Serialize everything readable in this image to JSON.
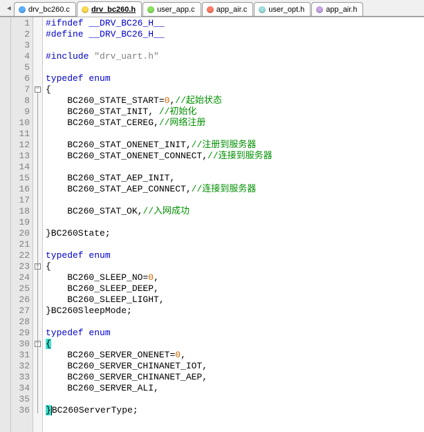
{
  "tabs": [
    {
      "label": "drv_bc260.c",
      "dot": "dot-blue",
      "active": false
    },
    {
      "label": "drv_bc260.h",
      "dot": "dot-yellow",
      "active": true
    },
    {
      "label": "user_app.c",
      "dot": "dot-green",
      "active": false
    },
    {
      "label": "app_air.c",
      "dot": "dot-red",
      "active": false
    },
    {
      "label": "user_opt.h",
      "dot": "dot-cyan",
      "active": false
    },
    {
      "label": "app_air.h",
      "dot": "dot-purple",
      "active": false
    }
  ],
  "nav_arrow": "◄",
  "fold_markers": [
    7,
    23,
    30
  ],
  "code_lines": [
    {
      "n": 1,
      "tokens": [
        [
          "#ifndef __DRV_BC26_H__",
          "c-kw"
        ]
      ]
    },
    {
      "n": 2,
      "tokens": [
        [
          "#define __DRV_BC26_H__",
          "c-kw"
        ]
      ]
    },
    {
      "n": 3,
      "tokens": []
    },
    {
      "n": 4,
      "tokens": [
        [
          "#include ",
          "c-kw"
        ],
        [
          "\"drv_uart.h\"",
          "c-str"
        ]
      ]
    },
    {
      "n": 5,
      "tokens": []
    },
    {
      "n": 6,
      "tokens": [
        [
          "typedef",
          "c-kw"
        ],
        [
          " ",
          ""
        ],
        [
          "enum",
          "c-kw"
        ]
      ]
    },
    {
      "n": 7,
      "tokens": [
        [
          "{",
          "c-id"
        ]
      ]
    },
    {
      "n": 8,
      "tokens": [
        [
          "    BC260_STATE_START",
          "c-id"
        ],
        [
          "=",
          "c-id"
        ],
        [
          "0",
          "c-num"
        ],
        [
          ",",
          "c-id"
        ],
        [
          "//起始状态",
          "c-com"
        ]
      ]
    },
    {
      "n": 9,
      "tokens": [
        [
          "    BC260_STAT_INIT, ",
          "c-id"
        ],
        [
          "//初始化",
          "c-com"
        ]
      ]
    },
    {
      "n": 10,
      "tokens": [
        [
          "    BC260_STAT_CEREG,",
          "c-id"
        ],
        [
          "//网络注册",
          "c-com"
        ]
      ]
    },
    {
      "n": 11,
      "tokens": []
    },
    {
      "n": 12,
      "tokens": [
        [
          "    BC260_STAT_ONENET_INIT,",
          "c-id"
        ],
        [
          "//注册到服务器",
          "c-com"
        ]
      ]
    },
    {
      "n": 13,
      "tokens": [
        [
          "    BC260_STAT_ONENET_CONNECT,",
          "c-id"
        ],
        [
          "//连接到服务器",
          "c-com"
        ]
      ]
    },
    {
      "n": 14,
      "tokens": []
    },
    {
      "n": 15,
      "tokens": [
        [
          "    BC260_STAT_AEP_INIT,",
          "c-id"
        ]
      ]
    },
    {
      "n": 16,
      "tokens": [
        [
          "    BC260_STAT_AEP_CONNECT,",
          "c-id"
        ],
        [
          "//连接到服务器",
          "c-com"
        ]
      ]
    },
    {
      "n": 17,
      "tokens": []
    },
    {
      "n": 18,
      "tokens": [
        [
          "    BC260_STAT_OK,",
          "c-id"
        ],
        [
          "//入网成功",
          "c-com"
        ]
      ]
    },
    {
      "n": 19,
      "tokens": []
    },
    {
      "n": 20,
      "tokens": [
        [
          "}BC260State;",
          "c-id"
        ]
      ]
    },
    {
      "n": 21,
      "tokens": []
    },
    {
      "n": 22,
      "tokens": [
        [
          "typedef",
          "c-kw"
        ],
        [
          " ",
          ""
        ],
        [
          "enum",
          "c-kw"
        ]
      ]
    },
    {
      "n": 23,
      "tokens": [
        [
          "{",
          "c-id"
        ]
      ]
    },
    {
      "n": 24,
      "tokens": [
        [
          "    BC260_SLEEP_NO",
          "c-id"
        ],
        [
          "=",
          "c-id"
        ],
        [
          "0",
          "c-num"
        ],
        [
          ",",
          "c-id"
        ]
      ]
    },
    {
      "n": 25,
      "tokens": [
        [
          "    BC260_SLEEP_DEEP,",
          "c-id"
        ]
      ]
    },
    {
      "n": 26,
      "tokens": [
        [
          "    BC260_SLEEP_LIGHT,",
          "c-id"
        ]
      ]
    },
    {
      "n": 27,
      "tokens": [
        [
          "}BC260SleepMode;",
          "c-id"
        ]
      ]
    },
    {
      "n": 28,
      "tokens": []
    },
    {
      "n": 29,
      "tokens": [
        [
          "typedef",
          "c-kw"
        ],
        [
          " ",
          ""
        ],
        [
          "enum",
          "c-kw"
        ]
      ]
    },
    {
      "n": 30,
      "tokens": [
        [
          "{",
          "hl-brace"
        ]
      ]
    },
    {
      "n": 31,
      "tokens": [
        [
          "    BC260_SERVER_ONENET",
          "c-id"
        ],
        [
          "=",
          "c-id"
        ],
        [
          "0",
          "c-num"
        ],
        [
          ",",
          "c-id"
        ]
      ]
    },
    {
      "n": 32,
      "tokens": [
        [
          "    BC260_SERVER_CHINANET_IOT,",
          "c-id"
        ]
      ]
    },
    {
      "n": 33,
      "tokens": [
        [
          "    BC260_SERVER_CHINANET_AEP,",
          "c-id"
        ]
      ]
    },
    {
      "n": 34,
      "tokens": [
        [
          "    BC260_SERVER_ALI,",
          "c-id"
        ]
      ]
    },
    {
      "n": 35,
      "tokens": []
    },
    {
      "n": 36,
      "tokens": [
        [
          "}",
          "hl-brace"
        ],
        [
          "BC260ServerType;",
          "c-id"
        ]
      ],
      "cursor_after_first": true
    }
  ]
}
